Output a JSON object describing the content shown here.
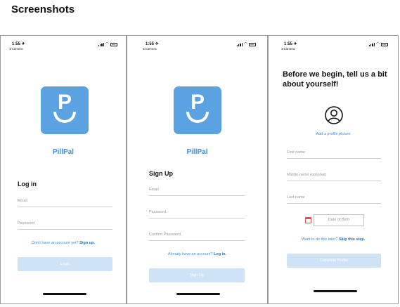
{
  "page": {
    "heading": "Screenshots"
  },
  "status_bar": {
    "time": "1:55 ✈",
    "back_label": "◂ Camera"
  },
  "login": {
    "app_name": "PillPal",
    "title": "Log in",
    "email_placeholder": "Email",
    "password_placeholder": "Password",
    "signup_prompt": "Don't have an account yet? ",
    "signup_link": "Sign up.",
    "button_label": "Login"
  },
  "signup": {
    "app_name": "PillPal",
    "title": "Sign Up",
    "email_placeholder": "Email",
    "password_placeholder": "Password",
    "confirm_placeholder": "Confirm Password",
    "login_prompt": "Already have an account? ",
    "login_link": "Log in.",
    "button_label": "Sign Up"
  },
  "profile": {
    "title": "Before we begin, tell us a bit about yourself!",
    "add_picture_label": "Add a profile picture",
    "first_name_placeholder": "First name",
    "middle_name_placeholder": "Middle name (optional)",
    "last_name_placeholder": "Last name",
    "dob_placeholder": "Date of Birth",
    "skip_prompt": "Want to do this later? ",
    "skip_link": "Skip this step.",
    "button_label": "Complete Profile"
  },
  "colors": {
    "brand_blue": "#5aa2e1",
    "link_blue": "#3a8fdc",
    "disabled_button": "#cfe3f6"
  },
  "icons": [
    "logo-p-smile",
    "profile-avatar-icon",
    "calendar-icon",
    "signal-icon",
    "wifi-icon",
    "battery-icon"
  ]
}
